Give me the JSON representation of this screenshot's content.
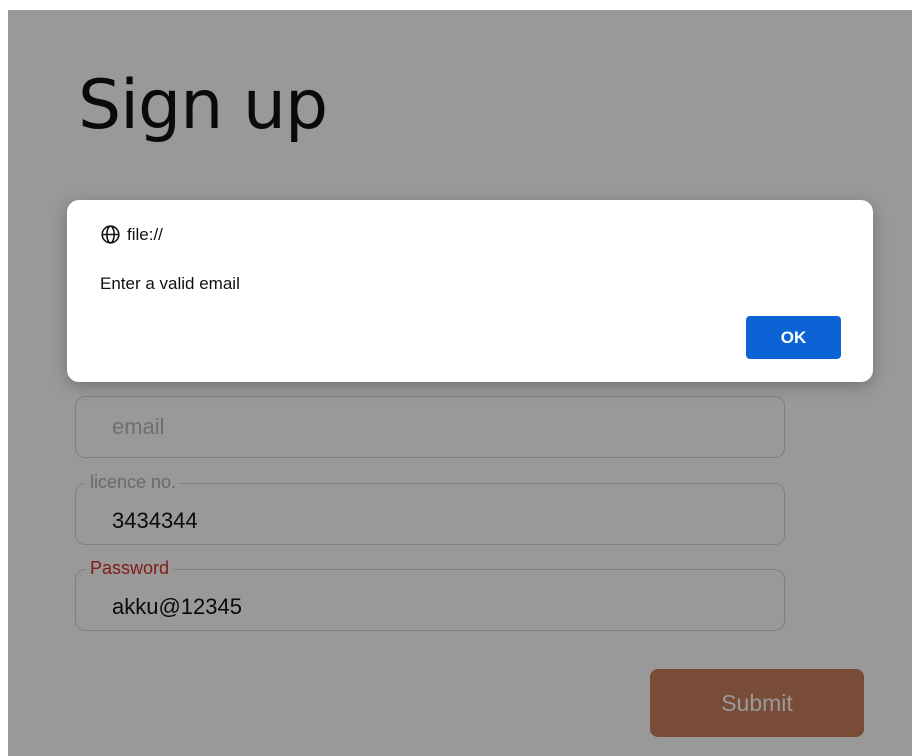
{
  "page": {
    "title": "Sign up"
  },
  "form": {
    "email": {
      "value": "",
      "placeholder": "email"
    },
    "licence": {
      "label": "licence no.",
      "value": "3434344"
    },
    "password": {
      "label": "Password",
      "value": "akku@12345"
    },
    "submit_label": "Submit"
  },
  "dialog": {
    "origin": "file://",
    "message": "Enter a valid email",
    "ok_label": "OK",
    "icon": "globe-icon"
  },
  "colors": {
    "submit": "#c97f5b",
    "ok": "#0b63d6",
    "error_label": "#d93025"
  }
}
